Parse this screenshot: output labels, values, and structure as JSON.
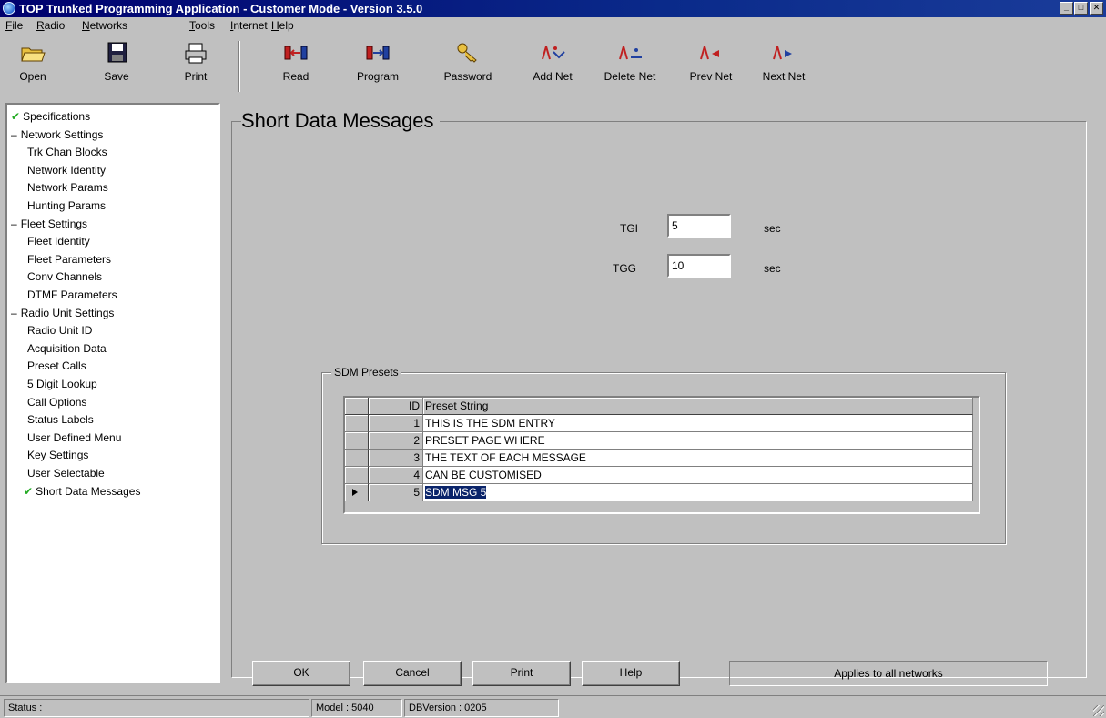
{
  "window": {
    "title": "TOP Trunked Programming Application - Customer Mode - Version 3.5.0"
  },
  "menu": [
    "File",
    "Radio",
    "Networks",
    "Tools",
    "Internet",
    "Help"
  ],
  "toolbar": {
    "open": "Open",
    "save": "Save",
    "print": "Print",
    "read": "Read",
    "program": "Program",
    "password": "Password",
    "add_net": "Add Net",
    "delete_net": "Delete Net",
    "prev_net": "Prev Net",
    "next_net": "Next Net"
  },
  "tree": [
    {
      "label": "Specifications",
      "checked": true
    },
    {
      "label": "Network Settings",
      "group": true
    },
    {
      "label": "Trk Chan Blocks"
    },
    {
      "label": "Network Identity"
    },
    {
      "label": "Network Params"
    },
    {
      "label": "Hunting Params"
    },
    {
      "label": "Fleet Settings",
      "group": true
    },
    {
      "label": "Fleet Identity"
    },
    {
      "label": "Fleet Parameters"
    },
    {
      "label": "Conv Channels"
    },
    {
      "label": "DTMF Parameters"
    },
    {
      "label": "Radio Unit Settings",
      "group": true
    },
    {
      "label": "Radio Unit ID"
    },
    {
      "label": "Acquisition Data"
    },
    {
      "label": "Preset Calls"
    },
    {
      "label": "5 Digit Lookup"
    },
    {
      "label": "Call Options"
    },
    {
      "label": "Status Labels"
    },
    {
      "label": "User Defined Menu"
    },
    {
      "label": "Key Settings"
    },
    {
      "label": "User Selectable"
    },
    {
      "label": "Short Data Messages",
      "checked": true
    }
  ],
  "page": {
    "title": "Short Data Messages",
    "tgi_label": "TGI",
    "tgi_value": "5",
    "tgi_unit": "sec",
    "tgg_label": "TGG",
    "tgg_value": "10",
    "tgg_unit": "sec",
    "group_label": "SDM Presets",
    "grid": {
      "headers": [
        "ID",
        "Preset String"
      ],
      "rows": [
        {
          "id": "1",
          "text": "THIS IS THE SDM ENTRY"
        },
        {
          "id": "2",
          "text": "PRESET PAGE WHERE"
        },
        {
          "id": "3",
          "text": "THE TEXT OF EACH MESSAGE"
        },
        {
          "id": "4",
          "text": "CAN BE CUSTOMISED"
        },
        {
          "id": "5",
          "text": "SDM MSG 5"
        }
      ]
    },
    "buttons": {
      "ok": "OK",
      "cancel": "Cancel",
      "print": "Print",
      "help": "Help"
    },
    "applies": "Applies to all networks"
  },
  "status": {
    "status": "Status :",
    "model": "Model : 5040",
    "db_version": "DBVersion : 0205"
  },
  "colors": {
    "titlebar": "#00006e",
    "selection": "#0a246a",
    "check": "#22aa22",
    "face": "#c0c0c0"
  }
}
